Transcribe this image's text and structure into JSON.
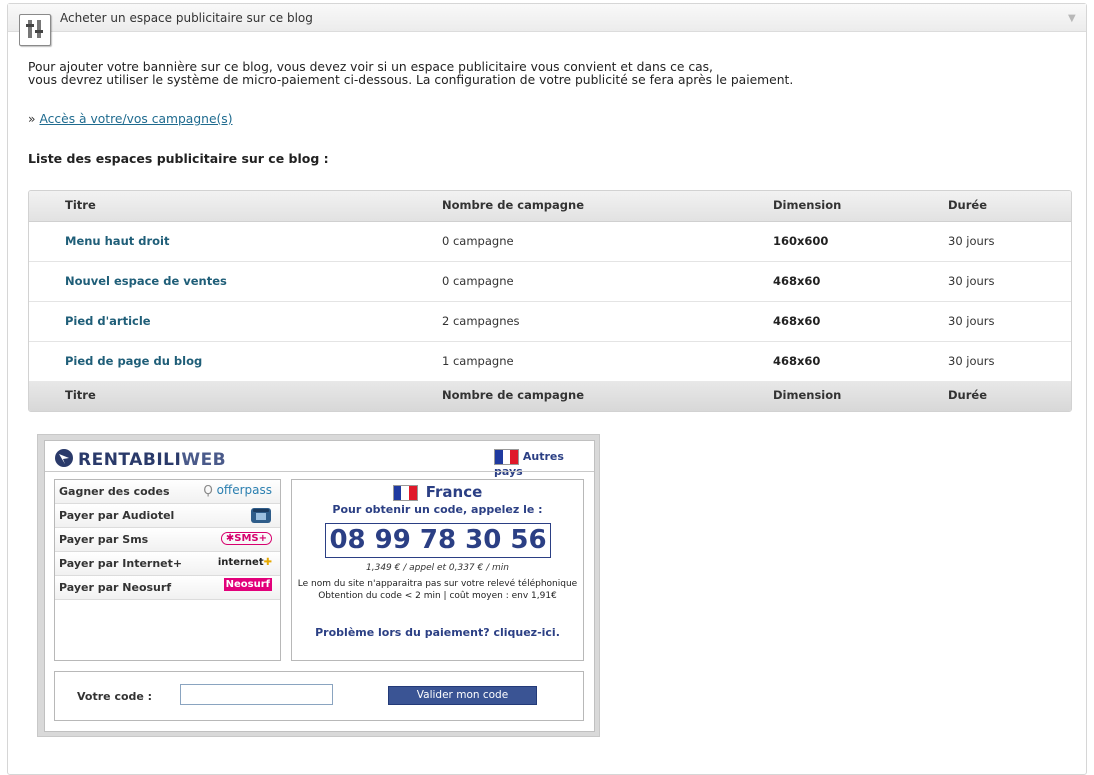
{
  "panel": {
    "title": "Acheter un espace publicitaire sur ce blog",
    "collapse_symbol": "▼",
    "icon": "tools-icon"
  },
  "intro": {
    "line1": "Pour ajouter votre bannière sur ce blog, vous devez voir si un espace publicitaire vous convient et dans ce cas,",
    "line2": "vous devrez utiliser le système de micro-paiement ci-dessous. La configuration de votre publicité se fera après le paiement."
  },
  "access": {
    "prefix": "»",
    "link": "Accès à votre/vos campagne(s)"
  },
  "list_title": "Liste des espaces publicitaire sur ce blog :",
  "table": {
    "headers": [
      "Titre",
      "Nombre de campagne",
      "Dimension",
      "Durée"
    ],
    "rows": [
      {
        "title": "Menu haut droit",
        "campaigns": "0 campagne",
        "dimension": "160x600",
        "duration": "30 jours"
      },
      {
        "title": "Nouvel espace de ventes",
        "campaigns": "0 campagne",
        "dimension": "468x60",
        "duration": "30 jours"
      },
      {
        "title": "Pied d'article",
        "campaigns": "2 campagnes",
        "dimension": "468x60",
        "duration": "30 jours"
      },
      {
        "title": "Pied de page du blog",
        "campaigns": "1 campagne",
        "dimension": "468x60",
        "duration": "30 jours"
      }
    ]
  },
  "payment": {
    "brand_a": "RENTABILI",
    "brand_b": "WEB",
    "other_countries": "Autres pays",
    "methods": [
      {
        "label": "Gagner des codes",
        "logo": "offerpass"
      },
      {
        "label": "Payer par Audiotel",
        "logo": "phone-icon"
      },
      {
        "label": "Payer par Sms",
        "logo": "SMS+"
      },
      {
        "label": "Payer par Internet+",
        "logo": "internet+"
      },
      {
        "label": "Payer par Neosurf",
        "logo": "Neosurf"
      }
    ],
    "country": "France",
    "get_code": "Pour obtenir un code, appelez le :",
    "phone": "08 99 78 30 56",
    "price": "1,349 € / appel et 0,337 € / min",
    "note1": "Le nom du site n'apparaitra pas sur votre relevé téléphonique",
    "note2": "Obtention du code < 2 min | coût moyen : env 1,91€",
    "problem": "Problème lors du paiement? cliquez-ici.",
    "code_label": "Votre code :",
    "code_value": "",
    "submit": "Valider mon code"
  },
  "colors": {
    "link": "#1f5e78",
    "brand_blue": "#2b3f84",
    "button": "#3a5494"
  }
}
